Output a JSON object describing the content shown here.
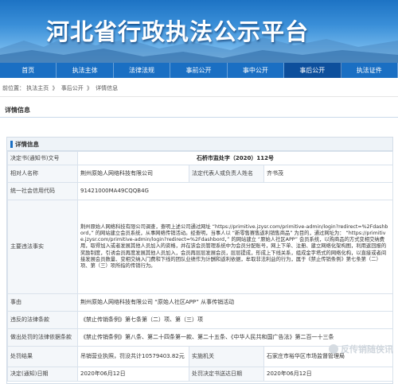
{
  "banner": {
    "title": "河北省行政执法公示平台"
  },
  "nav": {
    "items": [
      {
        "label": "首页",
        "active": false
      },
      {
        "label": "执法主体",
        "active": false
      },
      {
        "label": "法律法规",
        "active": false
      },
      {
        "label": "事前公开",
        "active": false
      },
      {
        "label": "事中公开",
        "active": false
      },
      {
        "label": "事后公开",
        "active": true
      },
      {
        "label": "执法证件",
        "active": false
      }
    ]
  },
  "breadcrumb": {
    "prefix": "前位置：",
    "crumbs": [
      "执法主页",
      "事后公开",
      "详情信息"
    ],
    "separator": "》"
  },
  "section": {
    "title": "详情信息"
  },
  "panel": {
    "title": "详情信息",
    "rows": {
      "doc_no_label": "决定书(通知书)文号",
      "doc_no_value": "石桥市监处字（2020）112号",
      "party_label": "相对人名称",
      "party_value": "荆州原始人网络科技有限公司",
      "legal_rep_label": "法定代表人或负责人姓名",
      "legal_rep_value": "齐书茂",
      "credit_code_label": "统一社会信用代码",
      "credit_code_value": "91421000MA49CQQB4G",
      "facts_label": "主要违法事实",
      "facts_value": "荆州原始人网络科技有限公司调查，查明上述公司通过网址 “https://primitive.jzysr.com/primitive-admin/login?redirect=%2Fdashbord，” 的网站建立会员系统，从事网络传销活动。经查明，当事人以 “新零售赛售返利销售商品” 为目的，通过网址为： “https://primitive.jzysr.com/primitive-admin/login?redirect=%2Fdashbord，” 的网站建立 “原始人社区APP” 会员系统，以购商品的方式变相交纳费用，取得加入或者发展其他人员加入的资格，并在该会员管理系统中为会员分配账号，网上下单、注册、建立网络化架构图，利用返回报的奖励制度，引诱会员再度发展其他人员加入，会员再层层发展会员，层层提成，形成上下线关系，组成金字塔式的网络化构，以直接或者间接发展会员数量、变相交纳入门费和下线的团队业绩作为计酬和返利依据，牟取非法利益的行为，属于《禁止传销条例》第七条第（二）项、第（三）项所指的传销行为。",
      "case_label": "事由",
      "case_value": "荆州原始人网络科技有限公司 “原始人社区APP” 从事传销活动",
      "violated_label": "违反的法律条款",
      "violated_value": "《禁止传销条例》第七条第（二）项、第（三）项",
      "basis_label": "做出处罚的法律依据条款",
      "basis_value": "《禁止传销条例》第八条、第二十四条第一款、第二十五条、《中华人民共和国广告法》第二百一十三条",
      "result_label": "处罚结果",
      "result_value": "吊销营业执照，罚没共计10579403.82元",
      "agency_label": "实施机关",
      "agency_value": "石家庄市裕华区市场监督管理局",
      "date_label": "决定(通知)日期",
      "date_value": "2020年06月12日",
      "deliver_label": "处罚决定书送达日期",
      "deliver_value": "2020年06月12日"
    }
  },
  "watermark": {
    "text": "反传销随侠讯"
  }
}
